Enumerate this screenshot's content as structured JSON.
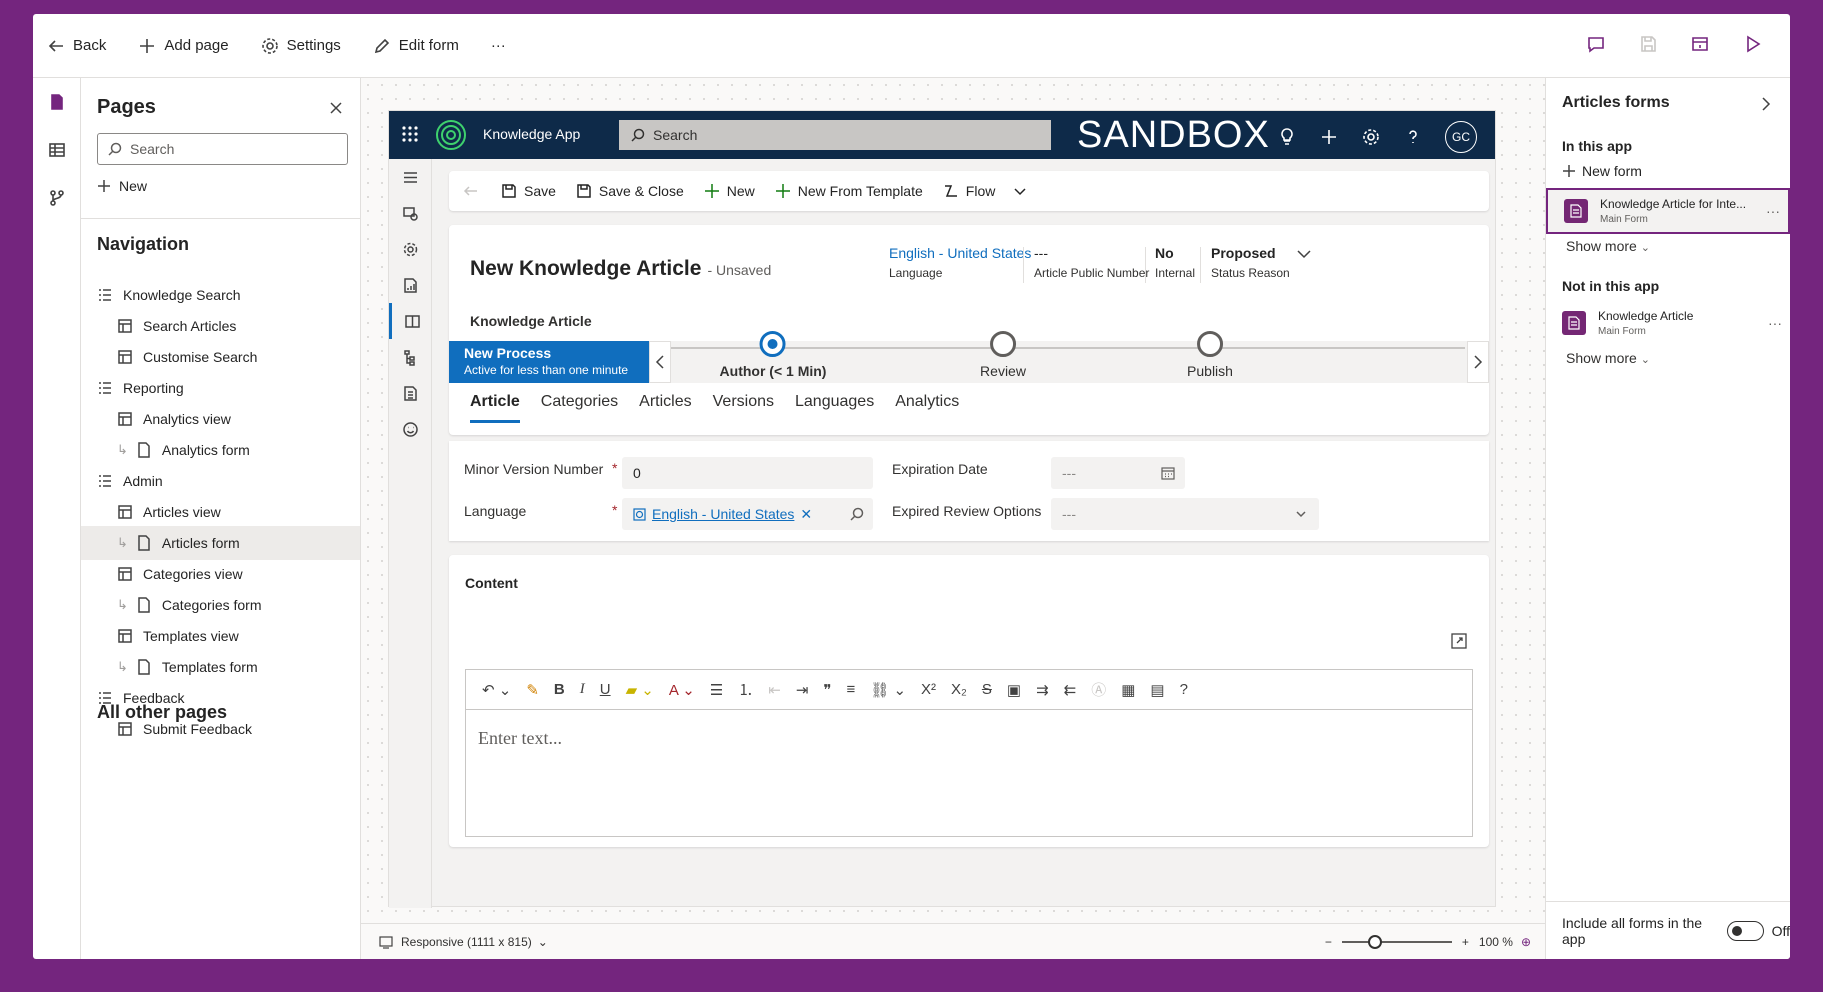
{
  "topbar": {
    "back": "Back",
    "add_page": "Add page",
    "settings": "Settings",
    "edit_form": "Edit form",
    "more": "···"
  },
  "pages": {
    "title": "Pages",
    "search_placeholder": "Search",
    "new": "New",
    "navigation_heading": "Navigation",
    "items": [
      {
        "label": "Knowledge Search",
        "type": "group"
      },
      {
        "label": "Search Articles",
        "type": "view"
      },
      {
        "label": "Customise Search",
        "type": "view"
      },
      {
        "label": "Reporting",
        "type": "group"
      },
      {
        "label": "Analytics view",
        "type": "view"
      },
      {
        "label": "Analytics form",
        "type": "form"
      },
      {
        "label": "Admin",
        "type": "group"
      },
      {
        "label": "Articles view",
        "type": "view"
      },
      {
        "label": "Articles form",
        "type": "form"
      },
      {
        "label": "Categories view",
        "type": "view"
      },
      {
        "label": "Categories form",
        "type": "form"
      },
      {
        "label": "Templates view",
        "type": "view"
      },
      {
        "label": "Templates form",
        "type": "form"
      },
      {
        "label": "Feedback",
        "type": "group"
      },
      {
        "label": "Submit Feedback",
        "type": "view"
      }
    ],
    "other_heading": "All other pages"
  },
  "app": {
    "name": "Knowledge App",
    "search_placeholder": "Search",
    "env": "SANDBOX",
    "avatar": "GC"
  },
  "cmd": {
    "save": "Save",
    "save_close": "Save & Close",
    "new": "New",
    "new_template": "New From Template",
    "flow": "Flow"
  },
  "header": {
    "title": "New Knowledge Article",
    "unsaved": "- Unsaved",
    "entity": "Knowledge Article",
    "fields": [
      {
        "value": "English - United States",
        "label": "Language"
      },
      {
        "value": "---",
        "label": "Article Public Number"
      },
      {
        "value": "No",
        "label": "Internal"
      },
      {
        "value": "Proposed",
        "label": "Status Reason"
      }
    ]
  },
  "bpf": {
    "process": "New Process",
    "active": "Active for less than one minute",
    "stages": [
      "Author  (< 1 Min)",
      "Review",
      "Publish"
    ]
  },
  "tabs": [
    "Article",
    "Categories",
    "Articles",
    "Versions",
    "Languages",
    "Analytics"
  ],
  "form": {
    "minor_version_label": "Minor Version Number",
    "minor_version_value": "0",
    "expiration_label": "Expiration Date",
    "expiration_value": "---",
    "language_label": "Language",
    "language_value": "English - United States",
    "expired_review_label": "Expired Review Options",
    "expired_review_value": "---"
  },
  "content": {
    "title": "Content",
    "placeholder": "Enter text..."
  },
  "status": {
    "responsive": "Responsive (1111 x 815)",
    "zoom": "100 %"
  },
  "rpanel": {
    "title": "Articles forms",
    "in_app": "In this app",
    "new_form": "New form",
    "form1_title": "Knowledge Article for Inte...",
    "form1_sub": "Main Form",
    "show_more": "Show more",
    "not_in_app": "Not in this app",
    "form2_title": "Knowledge Article",
    "form2_sub": "Main Form",
    "include_all": "Include all forms in the app",
    "toggle_state": "Off"
  },
  "colors": {
    "accent": "#106ebe",
    "brand": "#74257e",
    "appbar": "#0e2a49"
  }
}
